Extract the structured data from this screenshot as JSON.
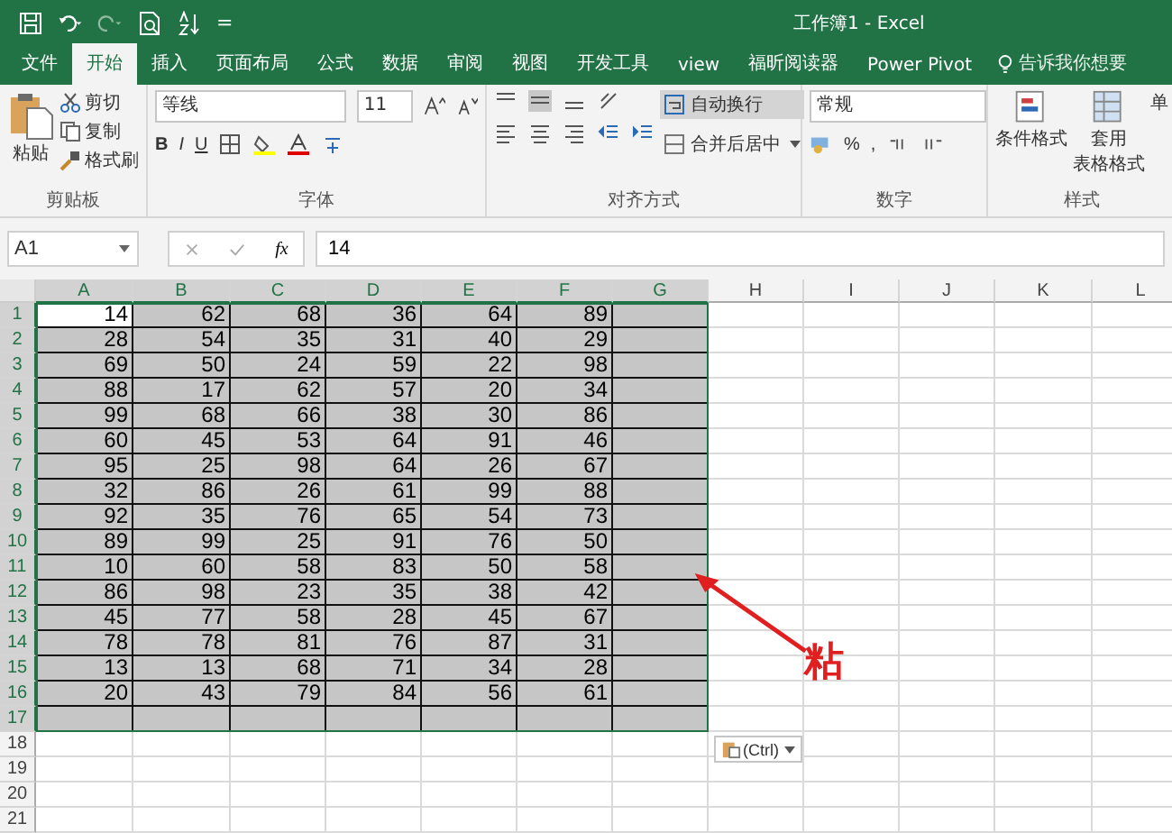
{
  "title_bar": {
    "title": "工作簿1  -  Excel",
    "quick_access_more": "="
  },
  "tabs": [
    {
      "label": "文件",
      "selected": false
    },
    {
      "label": "开始",
      "selected": true
    },
    {
      "label": "插入",
      "selected": false
    },
    {
      "label": "页面布局",
      "selected": false
    },
    {
      "label": "公式",
      "selected": false
    },
    {
      "label": "数据",
      "selected": false
    },
    {
      "label": "审阅",
      "selected": false
    },
    {
      "label": "视图",
      "selected": false
    },
    {
      "label": "开发工具",
      "selected": false
    },
    {
      "label": "view",
      "selected": false
    },
    {
      "label": "福昕阅读器",
      "selected": false
    },
    {
      "label": "Power Pivot",
      "selected": false
    }
  ],
  "tell_me": "告诉我你想要",
  "ribbon": {
    "clipboard": {
      "paste": "粘贴",
      "cut": "剪切",
      "copy": "复制",
      "format_painter": "格式刷",
      "label": "剪贴板"
    },
    "font": {
      "font_name": "等线",
      "font_size": "11",
      "bold": "B",
      "italic": "I",
      "underline": "U",
      "label": "字体"
    },
    "alignment": {
      "wrap_text": "自动换行",
      "wrap_selected": true,
      "merge": "合并后居中",
      "label": "对齐方式"
    },
    "number": {
      "format": "常规",
      "percent": "%",
      "comma": ",",
      "label": "数字"
    },
    "styles": {
      "conditional": "条件格式",
      "table_line1": "套用",
      "table_line2": "表格格式",
      "cell_styles": "单",
      "label": "样式"
    }
  },
  "formula_bar": {
    "name_box": "A1",
    "fx": "fx",
    "value": "14"
  },
  "sheet": {
    "columns": [
      {
        "label": "A",
        "selected": true,
        "active": true
      },
      {
        "label": "B",
        "selected": true,
        "active": false
      },
      {
        "label": "C",
        "selected": true,
        "active": false
      },
      {
        "label": "D",
        "selected": true,
        "active": false
      },
      {
        "label": "E",
        "selected": true,
        "active": false
      },
      {
        "label": "F",
        "selected": true,
        "active": false
      },
      {
        "label": "G",
        "selected": true,
        "active": false
      },
      {
        "label": "H",
        "selected": false,
        "active": false
      },
      {
        "label": "I",
        "selected": false,
        "active": false
      },
      {
        "label": "J",
        "selected": false,
        "active": false
      },
      {
        "label": "K",
        "selected": false,
        "active": false
      },
      {
        "label": "L",
        "selected": false,
        "active": false
      }
    ],
    "rows": [
      {
        "number": "1",
        "selected": true,
        "active": true,
        "cells": [
          "14",
          "62",
          "68",
          "36",
          "64",
          "89"
        ]
      },
      {
        "number": "2",
        "selected": true,
        "active": false,
        "cells": [
          "28",
          "54",
          "35",
          "31",
          "40",
          "29"
        ]
      },
      {
        "number": "3",
        "selected": true,
        "active": false,
        "cells": [
          "69",
          "50",
          "24",
          "59",
          "22",
          "98"
        ]
      },
      {
        "number": "4",
        "selected": true,
        "active": false,
        "cells": [
          "88",
          "17",
          "62",
          "57",
          "20",
          "34"
        ]
      },
      {
        "number": "5",
        "selected": true,
        "active": false,
        "cells": [
          "99",
          "68",
          "66",
          "38",
          "30",
          "86"
        ]
      },
      {
        "number": "6",
        "selected": true,
        "active": false,
        "cells": [
          "60",
          "45",
          "53",
          "64",
          "91",
          "46"
        ]
      },
      {
        "number": "7",
        "selected": true,
        "active": false,
        "cells": [
          "95",
          "25",
          "98",
          "64",
          "26",
          "67"
        ]
      },
      {
        "number": "8",
        "selected": true,
        "active": false,
        "cells": [
          "32",
          "86",
          "26",
          "61",
          "99",
          "88"
        ]
      },
      {
        "number": "9",
        "selected": true,
        "active": false,
        "cells": [
          "92",
          "35",
          "76",
          "65",
          "54",
          "73"
        ]
      },
      {
        "number": "10",
        "selected": true,
        "active": false,
        "cells": [
          "89",
          "99",
          "25",
          "91",
          "76",
          "50"
        ]
      },
      {
        "number": "11",
        "selected": true,
        "active": false,
        "cells": [
          "10",
          "60",
          "58",
          "83",
          "50",
          "58"
        ]
      },
      {
        "number": "12",
        "selected": true,
        "active": false,
        "cells": [
          "86",
          "98",
          "23",
          "35",
          "38",
          "42"
        ]
      },
      {
        "number": "13",
        "selected": true,
        "active": false,
        "cells": [
          "45",
          "77",
          "58",
          "28",
          "45",
          "67"
        ]
      },
      {
        "number": "14",
        "selected": true,
        "active": false,
        "cells": [
          "78",
          "78",
          "81",
          "76",
          "87",
          "31"
        ]
      },
      {
        "number": "15",
        "selected": true,
        "active": false,
        "cells": [
          "13",
          "13",
          "68",
          "71",
          "34",
          "28"
        ]
      },
      {
        "number": "16",
        "selected": true,
        "active": false,
        "cells": [
          "20",
          "43",
          "79",
          "84",
          "56",
          "61"
        ]
      },
      {
        "number": "17",
        "selected": true,
        "active": false
      },
      {
        "number": "18",
        "selected": false,
        "active": false
      },
      {
        "number": "19",
        "selected": false,
        "active": false
      },
      {
        "number": "20",
        "selected": false,
        "active": false
      },
      {
        "number": "21",
        "selected": false,
        "active": false
      }
    ]
  },
  "paste_options": "(Ctrl)",
  "annotation": "粘"
}
